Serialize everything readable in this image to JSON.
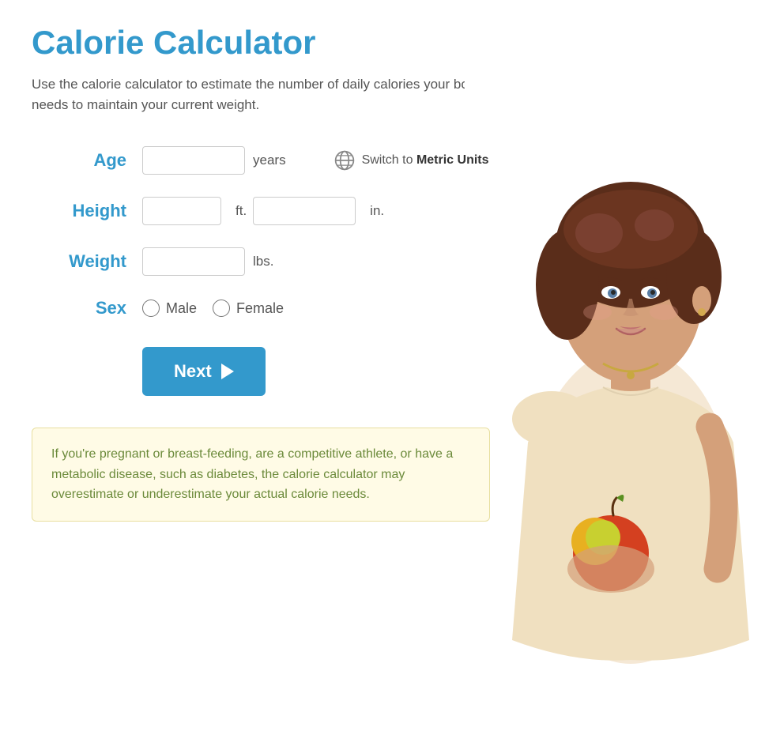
{
  "page": {
    "title": "Calorie Calculator",
    "subtitle": "Use the calorie calculator to estimate the number of daily calories your body needs to maintain your current weight.",
    "form": {
      "age_label": "Age",
      "age_unit": "years",
      "age_placeholder": "",
      "height_label": "Height",
      "height_ft_unit": "ft.",
      "height_in_unit": "in.",
      "height_ft_placeholder": "",
      "height_in_placeholder": "",
      "weight_label": "Weight",
      "weight_unit": "lbs.",
      "weight_placeholder": "",
      "sex_label": "Sex",
      "sex_options": [
        "Male",
        "Female"
      ],
      "switch_label_prefix": "Switch to ",
      "switch_label_bold": "Metric Units",
      "next_button": "Next"
    },
    "notice": "If you're pregnant or breast-feeding, are a competitive athlete, or have a metabolic disease, such as diabetes, the calorie calculator may overestimate or underestimate your actual calorie needs."
  }
}
